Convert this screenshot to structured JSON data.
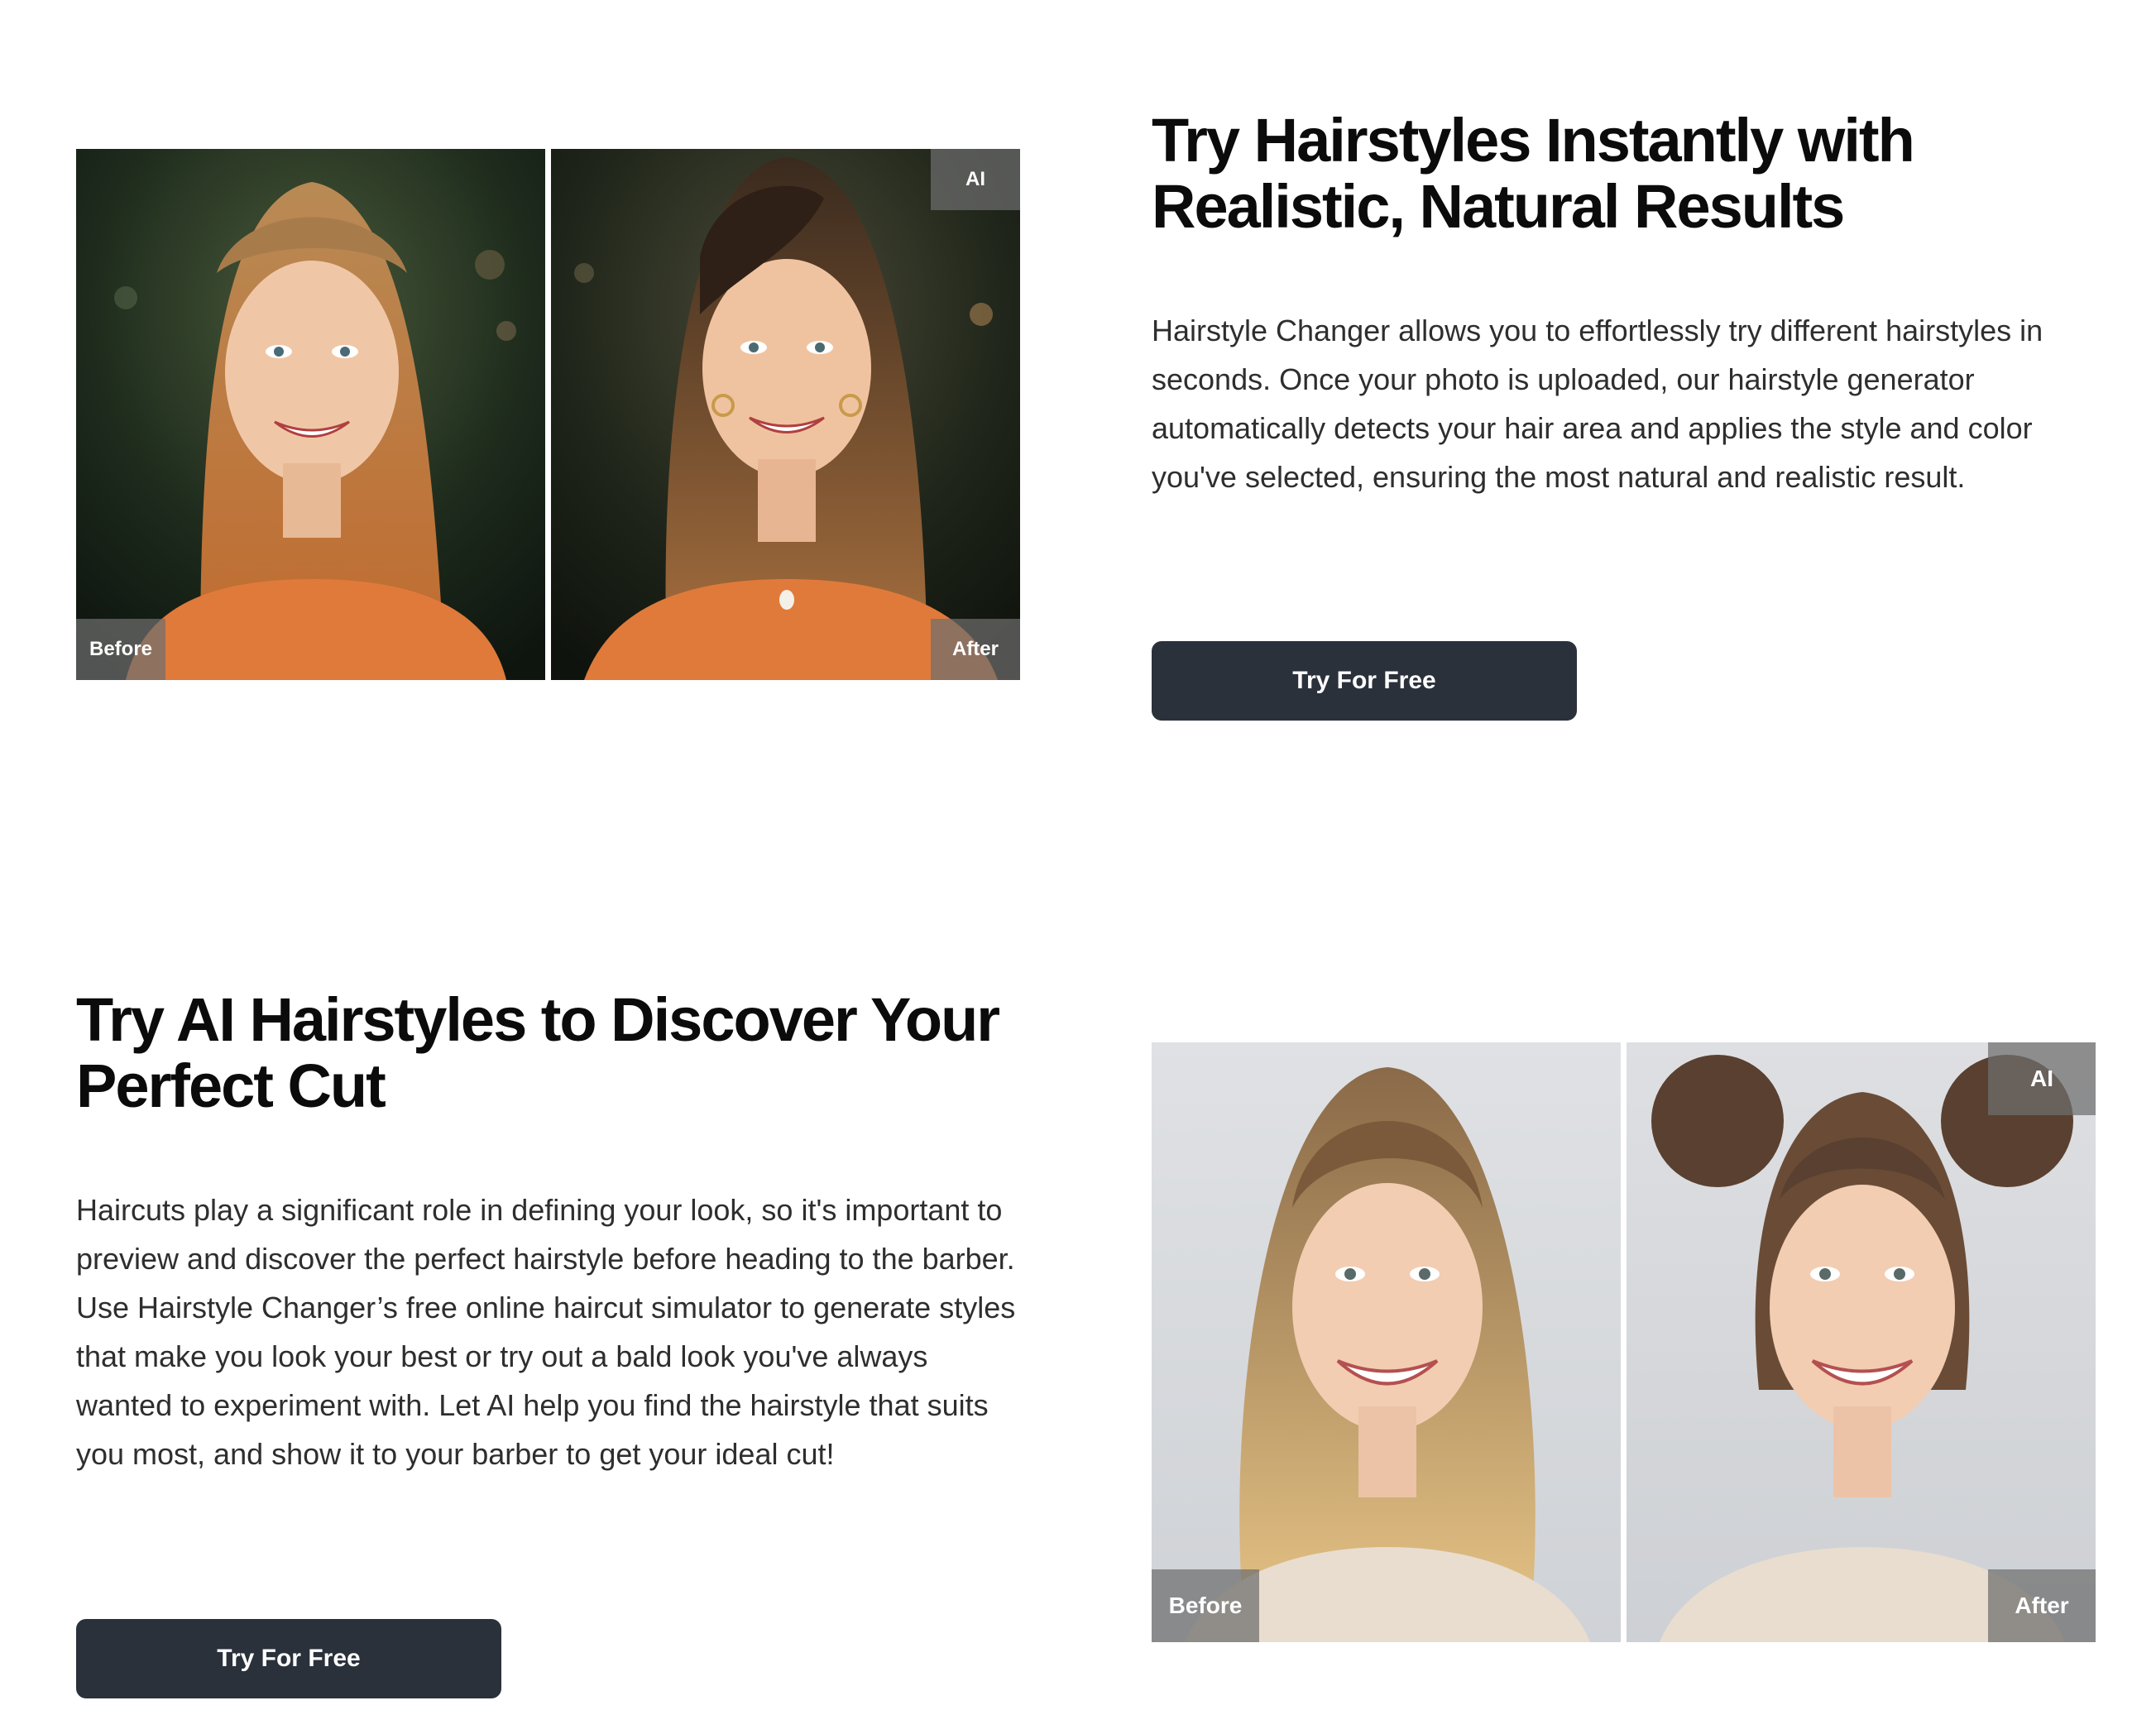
{
  "section_1": {
    "heading": "Try Hairstyles Instantly with Realistic, Natural Results",
    "body": "Hairstyle Changer allows you to effortlessly try different hairstyles in seconds. Once your photo is uploaded, our hairstyle generator automatically detects your hair area and applies the style and color you've selected, ensuring the most natural and realistic result.",
    "cta_label": "Try For Free",
    "before_label": "Before",
    "after_label": "After",
    "ai_badge": "AI"
  },
  "section_2": {
    "heading": "Try AI Hairstyles to Discover Your Perfect Cut",
    "body": "Haircuts play a significant role in defining your look, so it's important to preview and discover the perfect hairstyle before heading to the barber. Use Hairstyle Changer’s free online haircut simulator to generate styles that make you look your best or try out a bald look you've always wanted to experiment with. Let AI help you find the hairstyle that suits you most, and show it to your barber to get your ideal cut!",
    "cta_label": "Try For Free",
    "before_label": "Before",
    "after_label": "After",
    "ai_badge": "AI"
  },
  "colors": {
    "button_bg": "#2b313b",
    "button_text": "#ffffff",
    "heading": "#0b0b0b",
    "body_text": "#2e2e2e",
    "tag_bg": "rgba(110,110,110,0.72)"
  }
}
